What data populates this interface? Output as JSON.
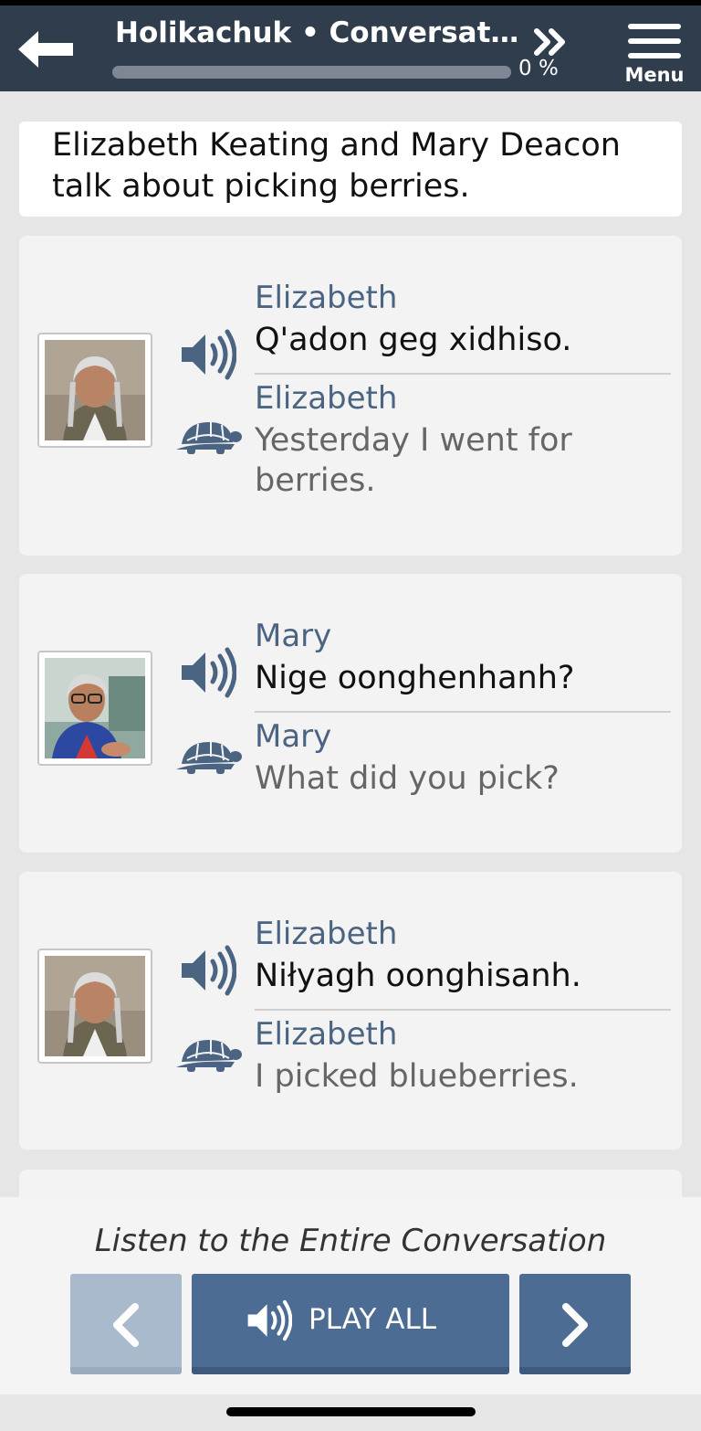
{
  "header": {
    "title": "Holikachuk • Conversatio...",
    "progress_label": "0 %",
    "progress_fraction": 0,
    "menu_label": "Menu"
  },
  "intro": "Elizabeth Keating and Mary Deacon talk about picking berries.",
  "lines": [
    {
      "speaker": "Elizabeth",
      "native": "Q'adon geg xidhiso.",
      "translation_speaker": "Elizabeth",
      "english": "Yesterday I went for berries."
    },
    {
      "speaker": "Mary",
      "native": "Nige oonghenhanh?",
      "translation_speaker": "Mary",
      "english": "What did you pick?"
    },
    {
      "speaker": "Elizabeth",
      "native": "Niłyagh oonghisanh.",
      "translation_speaker": "Elizabeth",
      "english": "I picked blueberries."
    }
  ],
  "footer": {
    "listen_label": "Listen to the Entire Conversation",
    "play_all_label": "PLAY ALL"
  },
  "colors": {
    "header_bg": "#2f3d4d",
    "accent": "#4d6c93",
    "name_text": "#4a6482",
    "icon": "#4a6482"
  }
}
